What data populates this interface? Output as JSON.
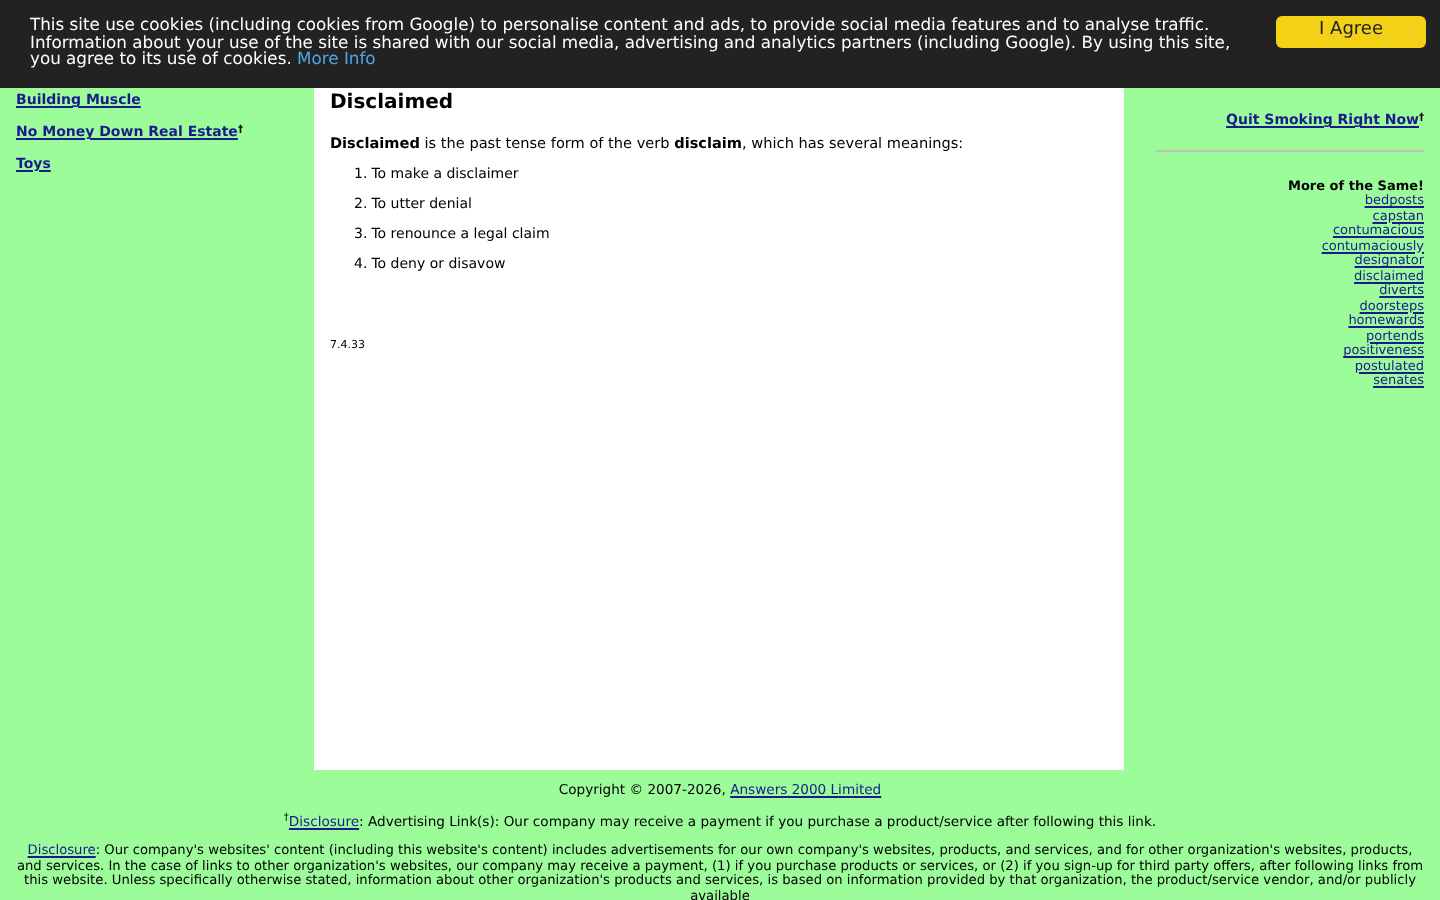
{
  "cookie_banner": {
    "message": "This site use cookies (including cookies from Google) to personalise content and ads, to provide social media features and to analyse traffic. Information about your use of the site is shared with our social media, advertising and analytics partners (including Google). By using this site, you agree to its use of cookies.",
    "link": "More Info",
    "button": "I Agree"
  },
  "left_links": [
    {
      "label": "Building Muscle",
      "dagger": false
    },
    {
      "label": "No Money Down Real Estate",
      "dagger": true
    },
    {
      "label": "Toys",
      "dagger": false
    }
  ],
  "article": {
    "title": "Disclaimed",
    "intro": "**Disclaimed** is the past tense form of the verb **disclaim**, which has several meanings:",
    "meanings": [
      {
        "number": "1.",
        "text": "To make a disclaimer"
      },
      {
        "number": "2.",
        "text": "To utter denial"
      },
      {
        "number": "3.",
        "text": "To renounce a legal claim"
      },
      {
        "number": "4.",
        "text": "To deny or disavow"
      }
    ],
    "version": "7.4.33"
  },
  "right_links": [
    {
      "label": "Quit Smoking Right Now",
      "dagger": true
    }
  ],
  "more": {
    "heading": "More of the Same!",
    "words": [
      "bedposts",
      "capstan",
      "contumacious",
      "contumaciously",
      "designator",
      "disclaimed",
      "diverts",
      "doorsteps",
      "homewards",
      "portends",
      "positiveness",
      "postulated",
      "senates"
    ]
  },
  "footer": {
    "copyright": "Copyright © 2007-2026,",
    "company": "Answers 2000 Limited",
    "dagger": "†",
    "disclosure_link": "Disclosure",
    "advertising": ": Advertising Link(s): Our company may receive a payment if you purchase a product/service after following this link.",
    "disclosure_link_2": "Disclosure",
    "disclosure_text": ": Our company's websites' content (including this website's content) includes advertisements for our own company's websites, products, and services, and for other organization's websites, products, and services. In the case of links to other organization's websites, our company may receive a payment, (1) if you purchase products or services, or (2) if you sign-up for third party offers, after following links from this website. Unless specifically otherwise stated, information about other organization's products and services, is based on information provided by that organization, the product/service vendor, and/or publicly available"
  }
}
